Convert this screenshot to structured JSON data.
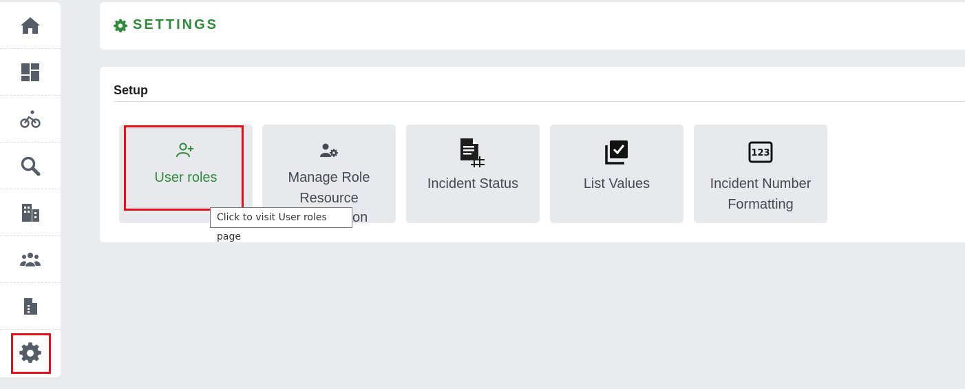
{
  "sidebar": {
    "items": [
      {
        "icon": "home-icon"
      },
      {
        "icon": "dashboard-icon"
      },
      {
        "icon": "bicycle-icon"
      },
      {
        "icon": "search-icon"
      },
      {
        "icon": "building-icon"
      },
      {
        "icon": "users-icon"
      },
      {
        "icon": "document-icon"
      },
      {
        "icon": "gear-icon"
      }
    ]
  },
  "header": {
    "title": "SETTINGS",
    "icon": "gear-icon",
    "accent": "#2e8b3a"
  },
  "setup": {
    "title": "Setup",
    "tiles": [
      {
        "label": "User roles",
        "icon": "user-plus-icon"
      },
      {
        "label": "Manage Role Resource",
        "icon": "user-gear-icon"
      },
      {
        "label": "Incident Status",
        "icon": "document-grid-icon"
      },
      {
        "label": "List Values",
        "icon": "checklist-icon"
      },
      {
        "label": "Incident Number Formatting",
        "icon": "number-123-icon"
      }
    ]
  },
  "tooltip": {
    "text": "Click to visit User roles page",
    "overflow_text": "on"
  },
  "colors": {
    "highlight": "#e8101a",
    "tile_bg": "#e7e9ed",
    "icon_gray": "#555d68"
  }
}
